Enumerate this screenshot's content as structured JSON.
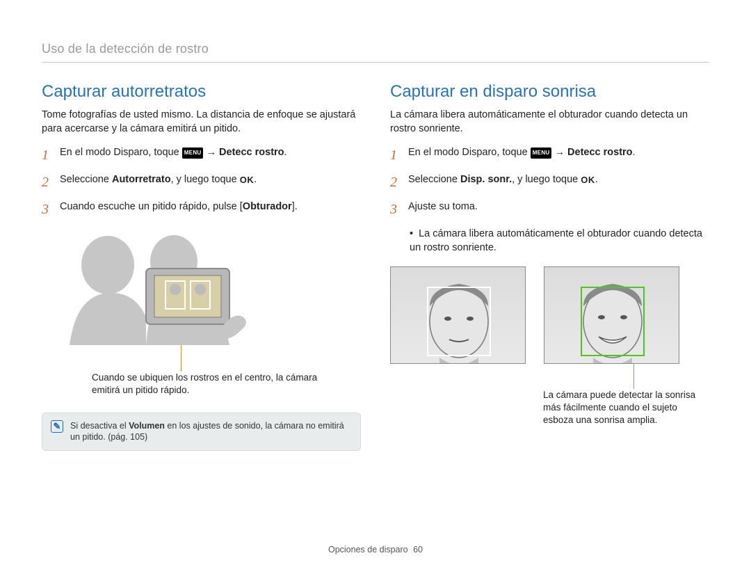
{
  "breadcrumb": "Uso de la detección de rostro",
  "left": {
    "heading": "Capturar autorretratos",
    "lead": "Tome fotografías de usted mismo. La distancia de enfoque se ajustará para acercarse y la cámara emitirá un pitido.",
    "steps": {
      "s1": {
        "num": "1",
        "pre": "En el modo Disparo, toque ",
        "menu": "MENU",
        "arrow": " → ",
        "bold": "Detecc rostro",
        "post": "."
      },
      "s2": {
        "num": "2",
        "pre": "Seleccione ",
        "bold": "Autorretrato",
        "mid": ", y luego toque ",
        "ok": "OK",
        "post": "."
      },
      "s3": {
        "num": "3",
        "pre": "Cuando escuche un pitido rápido, pulse [",
        "bold": "Obturador",
        "post": "]."
      }
    },
    "caption": "Cuando se ubiquen los rostros en el centro, la cámara emitirá un pitido rápido.",
    "note_pre": "Si desactiva el ",
    "note_bold": "Volumen",
    "note_post": " en los ajustes de sonido, la cámara no emitirá un pitido. (pág. 105)"
  },
  "right": {
    "heading": "Capturar en disparo sonrisa",
    "lead": "La cámara libera automáticamente el obturador cuando detecta un rostro sonriente.",
    "steps": {
      "s1": {
        "num": "1",
        "pre": "En el modo Disparo, toque ",
        "menu": "MENU",
        "arrow": " → ",
        "bold": "Detecc rostro",
        "post": "."
      },
      "s2": {
        "num": "2",
        "pre": "Seleccione ",
        "bold": "Disp. sonr.",
        "mid": ", y luego toque ",
        "ok": "OK",
        "post": "."
      },
      "s3": {
        "num": "3",
        "text": "Ajuste su toma."
      }
    },
    "bullet": "La cámara libera automáticamente el obturador cuando detecta un rostro sonriente.",
    "caption": "La cámara puede detectar la sonrisa más fácilmente cuando el sujeto esboza una sonrisa amplia."
  },
  "footer": {
    "section": "Opciones de disparo",
    "page": "60"
  }
}
